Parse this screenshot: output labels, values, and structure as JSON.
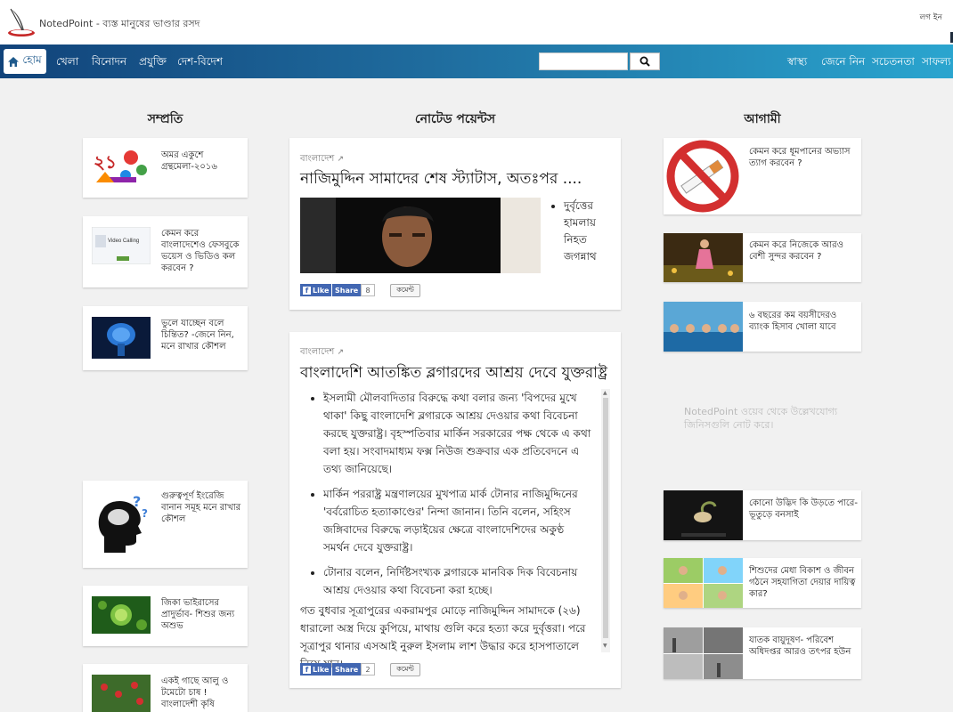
{
  "header": {
    "site_title": "NotedPoint - ব্যস্ত মানুষের ভাণ্ডার রসদ",
    "login": "লগ ইন"
  },
  "nav": {
    "home": "হোম",
    "items": [
      "খেলা",
      "বিনোদন",
      "প্রযুক্তি",
      "দেশ-বিদেশ"
    ],
    "right_items": [
      "স্বাস্থ্য",
      "জেনে নিন",
      "সচেতনতা",
      "সাফল্য"
    ],
    "search_placeholder": ""
  },
  "columns": {
    "left": "সম্প্রতি",
    "center": "নোটেড পয়েন্টস",
    "right": "আগামী"
  },
  "left_cards": [
    "অমর একুশে গ্রন্থমেলা-২০১৬",
    "কেমন করে বাংলাদেশেও ফেসবুকে ভয়েস ও ভিডিও কল করবেন ?",
    "ভুলে যাচ্ছেন বলে চিন্তিত? -জেনে নিন, মনে রাখার কৌশল",
    "গুরুত্বপূর্ণ ইংরেজি বানান সমূহ মনে রাখার কৌশল",
    "জিকা ভাইরাসের প্রাদুর্ভাব- শিশুর জন্য অশুভ",
    "একই গাছে আলু ও টমেটো চাষ ! বাংলাদেশী কৃষি"
  ],
  "left_thumb_texts": {
    "video_calling": "Video Calling"
  },
  "articles": [
    {
      "category": "বাংলাদেশ",
      "title": "নাজিমুদ্দিন সামাদের শেষ স্ট্যাটাস, অতঃপর ....",
      "bullet": "দুর্বৃত্তের হামলায় নিহত জগন্নাথ",
      "like": "Like",
      "share": "Share",
      "share_count": "8",
      "comment": "কমেন্ট"
    },
    {
      "category": "বাংলাদেশ",
      "title": "বাংলাদেশি আতঙ্কিত ব্লগারদের আশ্রয় দেবে যুক্তরাষ্ট্র",
      "bullets": [
        "ইসলামী মৌলবাদিতার বিরুদ্ধে কথা বলার জন্য 'বিপদের মুখে থাকা' কিছু বাংলাদেশি ব্লগারকে আশ্রয় দেওয়ার কথা বিবেচনা করছে যুক্তরাষ্ট্র। বৃহস্পতিবার মার্কিন সরকারের পক্ষ থেকে এ কথা বলা হয়। সংবাদমাধ্যম ফক্স নিউজ শুক্রবার এক প্রতিবেদনে এ তথ্য জানিয়েছে।",
        "মার্কিন পররাষ্ট্র মন্ত্রণালয়ের মুখপাত্র মার্ক টোনার নাজিমুদ্দিনের 'বর্বরোচিত হত্যাকাণ্ডের' নিন্দা জানান। তিনি বলেন, সহিংস জঙ্গিবাদের বিরুদ্ধে লড়াইয়ের ক্ষেত্রে বাংলাদেশিদের অকুণ্ঠ সমর্থন দেবে যুক্তরাষ্ট্র।",
        "টোনার বলেন, নির্দিষ্টসংখ্যক ব্লগারকে মানবিক দিক বিবেচনায় আশ্রয় দেওয়ার কথা বিবেচনা করা হচ্ছে।"
      ],
      "paragraph": "গত বুধবার সূত্রাপুরের একরামপুর মোড়ে নাজিমুদ্দিন সামাদকে (২৬) ধারালো অস্ত্র দিয়ে কুপিয়ে, মাথায় গুলি করে হত্যা করে দুর্বৃত্তরা। পরে সূত্রাপুর থানার এসআই নুরুল ইসলাম লাশ উদ্ধার করে হাসপাতালে নিয়ে যান।",
      "like": "Like",
      "share": "Share",
      "share_count": "2",
      "comment": "কমেন্ট"
    }
  ],
  "right_cards": [
    "কেমন করে ধূমপানের অভ্যাস ত্যাগ করবেন ?",
    "কেমন করে নিজেকে আরও বেশী সুন্দর করবেন ?",
    "৬ বছরের কম বয়সীদেরও ব্যাংক হিসাব খোলা যাবে",
    "কোনো উদ্ভিদ কি উড়তে পারে- ভূতুড়ে বনসাই",
    "শিশুদের মেধা বিকাশ ও জীবন গঠনে সহযাগিতা দেয়ার দায়িত্ব কার?",
    "যাতক বায়ুদূষণ- পরিবেশ অধিদপ্তর আরও তৎপর হউন"
  ],
  "right_info": "NotedPoint ওয়েব থেকে উল্লেখযোগ্য জিনিসগুলি নোট করে।",
  "colors": {
    "nav_start": "#11437a",
    "nav_end": "#2aa5cf",
    "facebook": "#4267b2"
  }
}
